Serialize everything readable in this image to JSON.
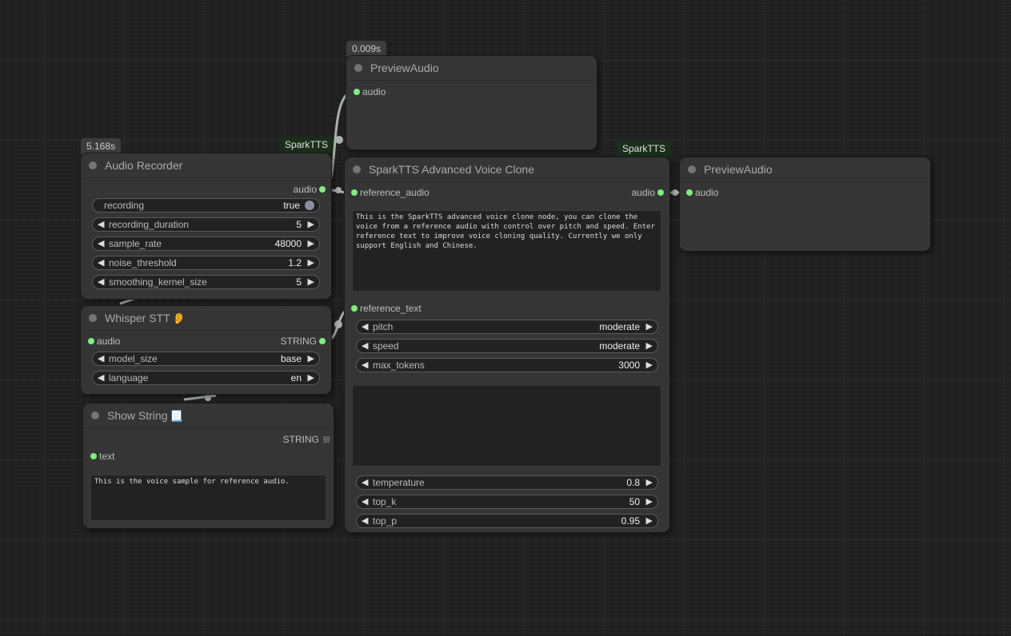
{
  "colors": {
    "canvas_bg": "#222222",
    "node_bg": "#353535",
    "link": "#a9b1a9",
    "pin_active": "#7cf07c",
    "tag_bg": "#1a2e1a"
  },
  "timings": {
    "preview_top": "0.009s",
    "audio_recorder": "5.168s"
  },
  "tags": {
    "recorder": "SparkTTS",
    "voice_clone": "SparkTTS"
  },
  "audio_recorder": {
    "title": "Audio Recorder",
    "output": "audio",
    "widgets": {
      "recording": {
        "name": "recording",
        "value": "true"
      },
      "recording_duration": {
        "name": "recording_duration",
        "value": "5"
      },
      "sample_rate": {
        "name": "sample_rate",
        "value": "48000"
      },
      "noise_threshold": {
        "name": "noise_threshold",
        "value": "1.2"
      },
      "smoothing_kernel_size": {
        "name": "smoothing_kernel_size",
        "value": "5"
      }
    }
  },
  "whisper": {
    "title": "Whisper STT",
    "emoji": "👂",
    "input": "audio",
    "output": "STRING",
    "widgets": {
      "model_size": {
        "name": "model_size",
        "value": "base"
      },
      "language": {
        "name": "language",
        "value": "en"
      }
    }
  },
  "show_string": {
    "title": "Show String",
    "emoji": "📃",
    "output": "STRING",
    "input": "text",
    "text": "This is the voice sample for reference audio."
  },
  "preview_top": {
    "title": "PreviewAudio",
    "input": "audio"
  },
  "voice_clone": {
    "title": "SparkTTS Advanced Voice Clone",
    "input_reference_audio": "reference_audio",
    "output": "audio",
    "description": "This is the SparkTTS advanced voice clone node, you can clone the voice from a reference audio with control over pitch and speed. Enter reference text to improve voice cloning quality. Currently we only support English and Chinese.",
    "input_reference_text": "reference_text",
    "widgets": {
      "pitch": {
        "name": "pitch",
        "value": "moderate"
      },
      "speed": {
        "name": "speed",
        "value": "moderate"
      },
      "max_tokens": {
        "name": "max_tokens",
        "value": "3000"
      },
      "temperature": {
        "name": "temperature",
        "value": "0.8"
      },
      "top_k": {
        "name": "top_k",
        "value": "50"
      },
      "top_p": {
        "name": "top_p",
        "value": "0.95"
      }
    },
    "text_box": ""
  },
  "preview_right": {
    "title": "PreviewAudio",
    "input": "audio"
  },
  "glyphs": {
    "arrow_left": "◀",
    "arrow_right": "▶"
  }
}
